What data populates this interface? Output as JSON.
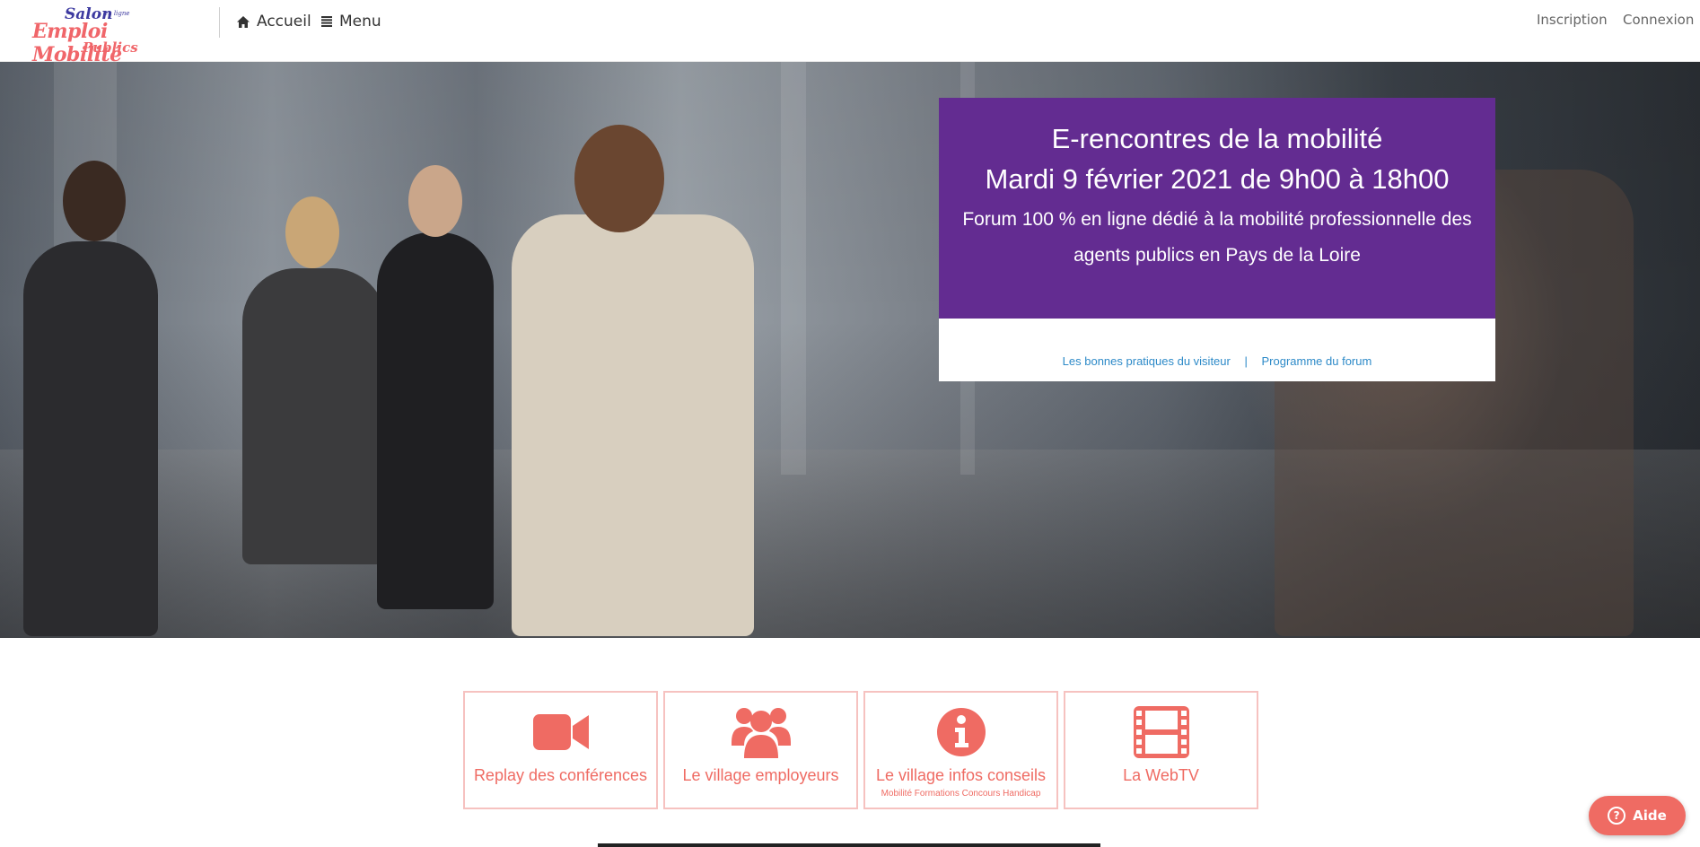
{
  "header": {
    "logo": {
      "line1": "Salon",
      "line1_small": "en ligne",
      "line2": "Emploi Mobilité",
      "line3": "Publics"
    },
    "home_label": "Accueil",
    "menu_label": "Menu",
    "signup_label": "Inscription",
    "login_label": "Connexion"
  },
  "hero": {
    "title": "E-rencontres de la mobilité",
    "date": "Mardi 9 février 2021 de 9h00 à 18h00",
    "description": "Forum 100 % en ligne dédié à la mobilité professionnelle des agents publics en Pays de la Loire",
    "link_practices": "Les bonnes pratiques du visiteur",
    "separator": "|",
    "link_program": "Programme du forum"
  },
  "tiles": [
    {
      "label": "Replay des conférences",
      "icon": "video-camera-icon"
    },
    {
      "label": "Le village employeurs",
      "icon": "users-group-icon"
    },
    {
      "label": "Le village infos conseils",
      "sub": "Mobilité Formations Concours Handicap",
      "icon": "info-circle-icon"
    },
    {
      "label": "La WebTV",
      "icon": "film-icon"
    }
  ],
  "help": {
    "label": "Aide",
    "icon": "question-circle-icon"
  },
  "colors": {
    "purple": "#632c91",
    "coral": "#ef6b63",
    "link_blue": "#2d8ac8"
  }
}
